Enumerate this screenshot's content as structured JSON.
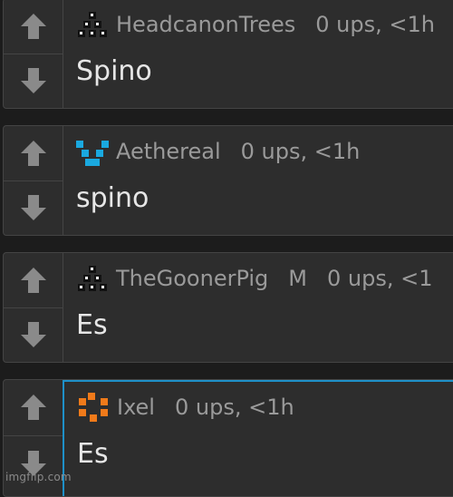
{
  "comments": [
    {
      "username": "HeadcanonTrees",
      "mod": "",
      "meta": "0 ups, <1h",
      "text": "Spino",
      "avatar": "black-dots-triangle-icon"
    },
    {
      "username": "Aethereal",
      "mod": "",
      "meta": "0 ups, <1h",
      "text": "spino",
      "avatar": "cyan-pixel-avatar-icon"
    },
    {
      "username": "TheGoonerPig",
      "mod": "M",
      "meta": "0 ups, <1",
      "text": "Es",
      "avatar": "black-dots-triangle-icon"
    },
    {
      "username": "Ixel",
      "mod": "",
      "meta": "0 ups, <1h",
      "text": "Es",
      "avatar": "orange-pixel-avatar-icon"
    }
  ],
  "colors": {
    "accent_border": "#1e90c8",
    "cyan_avatar": "#1aa9e0",
    "orange_avatar": "#f07a1a"
  },
  "watermark": "imgflip.com"
}
